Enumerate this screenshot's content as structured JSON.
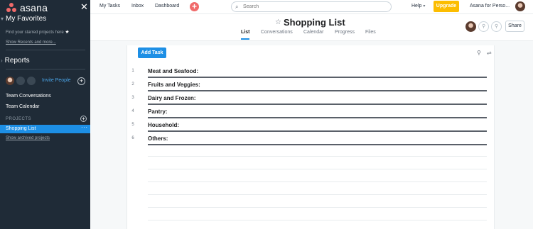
{
  "sidebar": {
    "logo_text": "asana",
    "close_icon": "close-icon",
    "favorites_heading": "My Favorites",
    "favorites_hint": "Find your starred projects here",
    "show_recents": "Show Recents and more...",
    "reports_heading": "Reports",
    "invite_label": "Invite People",
    "team_items": [
      {
        "label": "Team Conversations"
      },
      {
        "label": "Team Calendar"
      }
    ],
    "projects_label": "PROJECTS",
    "projects": [
      {
        "label": "Shopping List",
        "selected": true,
        "more": "···"
      }
    ],
    "show_archived": "Show archived projects"
  },
  "topbar": {
    "nav": [
      {
        "label": "My Tasks"
      },
      {
        "label": "Inbox"
      },
      {
        "label": "Dashboard"
      }
    ],
    "add_label": "+",
    "search_placeholder": "Search",
    "help_label": "Help",
    "help_chevron": "▾",
    "upgrade_label": "Upgrade",
    "org_label": "Asana for Perso..."
  },
  "project": {
    "title": "Shopping List",
    "chevron": "˅",
    "tabs": [
      {
        "label": "List",
        "active": true
      },
      {
        "label": "Conversations"
      },
      {
        "label": "Calendar"
      },
      {
        "label": "Progress"
      },
      {
        "label": "Files"
      }
    ],
    "share_label": "Share"
  },
  "list": {
    "add_task_label": "Add Task",
    "rows": [
      {
        "num": "1",
        "name": "Meat and Seafood:"
      },
      {
        "num": "2",
        "name": "Fruits and Veggies:"
      },
      {
        "num": "3",
        "name": "Dairy and Frozen:"
      },
      {
        "num": "4",
        "name": "Pantry:"
      },
      {
        "num": "5",
        "name": "Household:"
      },
      {
        "num": "6",
        "name": "Others:"
      }
    ]
  },
  "colors": {
    "sidebar_bg": "#1f2b37",
    "accent_blue": "#1d8fe5",
    "upgrade_yellow": "#fcbd01",
    "brand_coral": "#f06a6a"
  }
}
